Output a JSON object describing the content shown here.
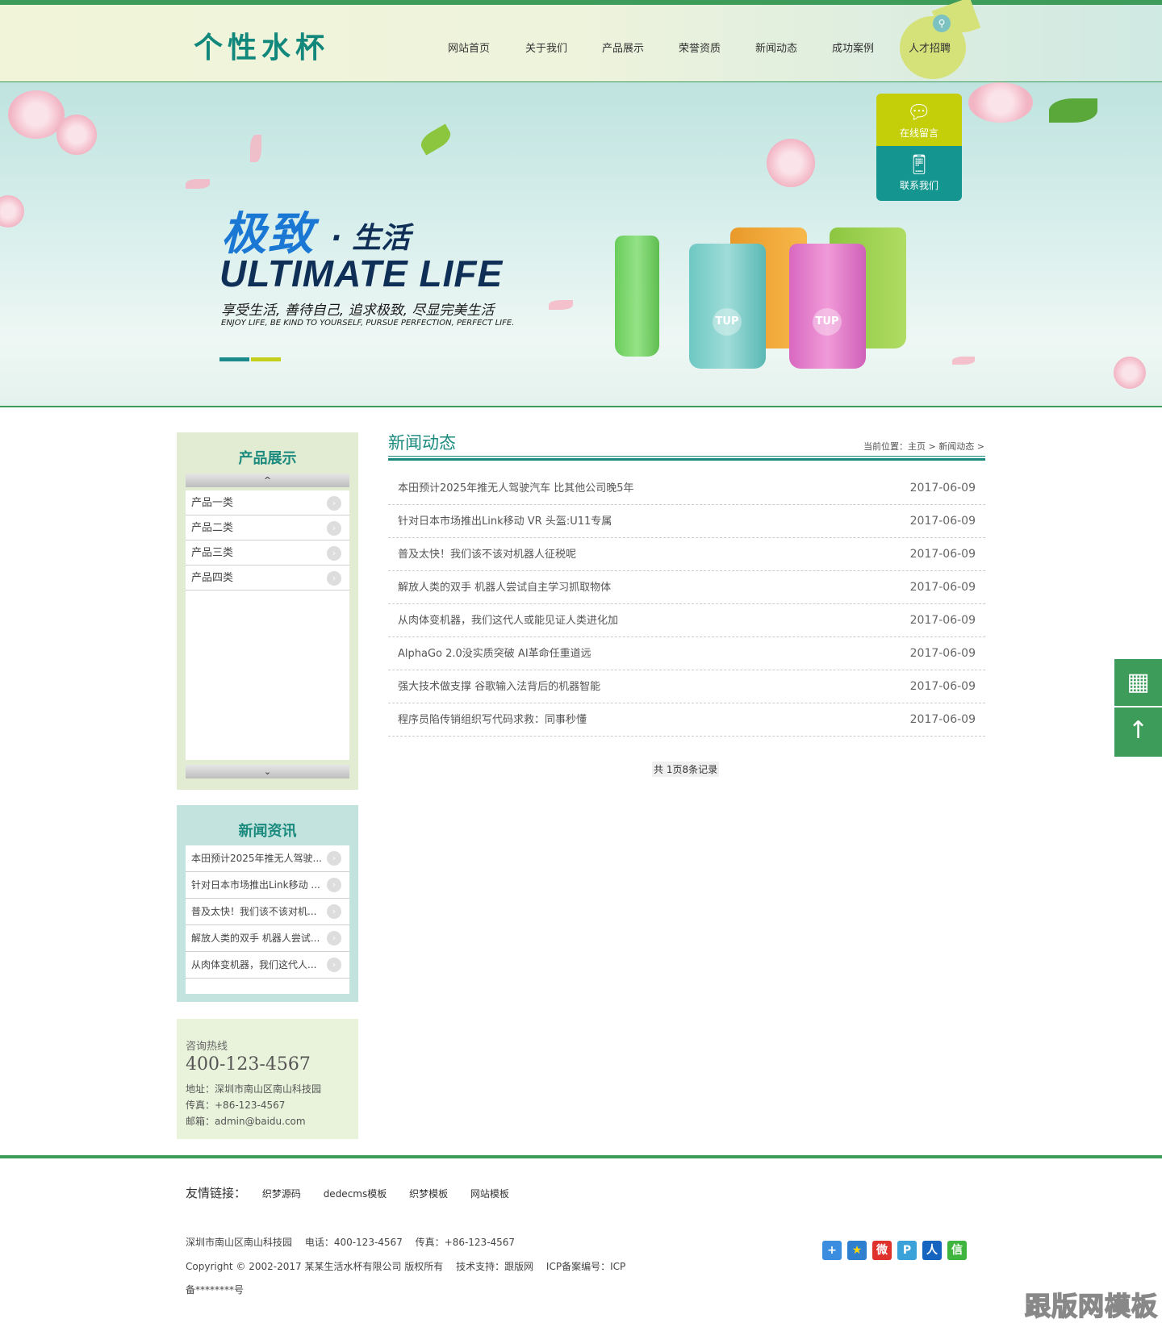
{
  "header": {
    "logo": "个性水杯",
    "nav": [
      "网站首页",
      "关于我们",
      "产品展示",
      "荣誉资质",
      "新闻动态",
      "成功案例",
      "人才招聘"
    ]
  },
  "banner": {
    "title_cn1": "极致",
    "title_cn2": "· 生活",
    "title_en": "ULTIMATE  LIFE",
    "slogan_cn": "享受生活, 善待自己, 追求极致, 尽显完美生活",
    "slogan_en": "ENJOY LIFE, BE KIND TO YOURSELF, PURSUE PERFECTION, PERFECT LIFE.",
    "cup_label": "TUP",
    "online_msg": "在线留言",
    "contact_us": "联系我们"
  },
  "sidebar": {
    "products": {
      "title": "产品展示",
      "up": "^",
      "down": "⌄",
      "items": [
        "产品一类",
        "产品二类",
        "产品三类",
        "产品四类"
      ]
    },
    "news": {
      "title": "新闻资讯",
      "items": [
        "本田预计2025年推无人驾驶...",
        "针对日本市场推出Link移动 ...",
        "普及太快！我们该不该对机...",
        "解放人类的双手 机器人尝试...",
        "从肉体变机器，我们这代人..."
      ]
    },
    "hotline": {
      "label": "咨询热线",
      "number": "400-123-4567",
      "address": "地址：深圳市南山区南山科技园",
      "fax": "传真：+86-123-4567",
      "email": "邮箱：admin@baidu.com"
    }
  },
  "content": {
    "title": "新闻动态",
    "breadcrumb": "当前位置：主页 > 新闻动态 >",
    "rows": [
      {
        "title": "本田预计2025年推无人驾驶汽车 比其他公司晚5年",
        "date": "2017-06-09"
      },
      {
        "title": "针对日本市场推出Link移动 VR 头盔:U11专属",
        "date": "2017-06-09"
      },
      {
        "title": "普及太快！我们该不该对机器人征税呢",
        "date": "2017-06-09"
      },
      {
        "title": "解放人类的双手 机器人尝试自主学习抓取物体",
        "date": "2017-06-09"
      },
      {
        "title": "从肉体变机器，我们这代人或能见证人类进化加",
        "date": "2017-06-09"
      },
      {
        "title": "AlphaGo 2.0没实质突破 AI革命任重道远",
        "date": "2017-06-09"
      },
      {
        "title": "强大技术做支撑 谷歌输入法背后的机器智能",
        "date": "2017-06-09"
      },
      {
        "title": "程序员陷传销组织写代码求救：同事秒懂",
        "date": "2017-06-09"
      }
    ],
    "pager": "共 1页8条记录"
  },
  "floating": {
    "qr": "▦",
    "top": "↑"
  },
  "footer": {
    "links_label": "友情链接：",
    "links": [
      "织梦源码",
      "dedecms模板",
      "织梦模板",
      "网站模板"
    ],
    "info": "深圳市南山区南山科技园　 电话：400-123-4567　 传真：+86-123-4567",
    "copyright": "Copyright © 2002-2017 某某生活水杯有限公司 版权所有　 技术支持：跟版网　 ICP备案编号：ICP",
    "icp": "备********号",
    "social": [
      {
        "icon": "+",
        "color": "#3b8de0"
      },
      {
        "icon": "★",
        "color": "#2f7fd0"
      },
      {
        "icon": "微",
        "color": "#e0322c"
      },
      {
        "icon": "P",
        "color": "#3aa2d8"
      },
      {
        "icon": "人",
        "color": "#1565c0"
      },
      {
        "icon": "信",
        "color": "#3fb53f"
      }
    ]
  },
  "watermark": "跟版网模板",
  "colors": {
    "primary": "#3d9c5a",
    "teal": "#1b8a7e",
    "lime": "#c4cf0a"
  }
}
